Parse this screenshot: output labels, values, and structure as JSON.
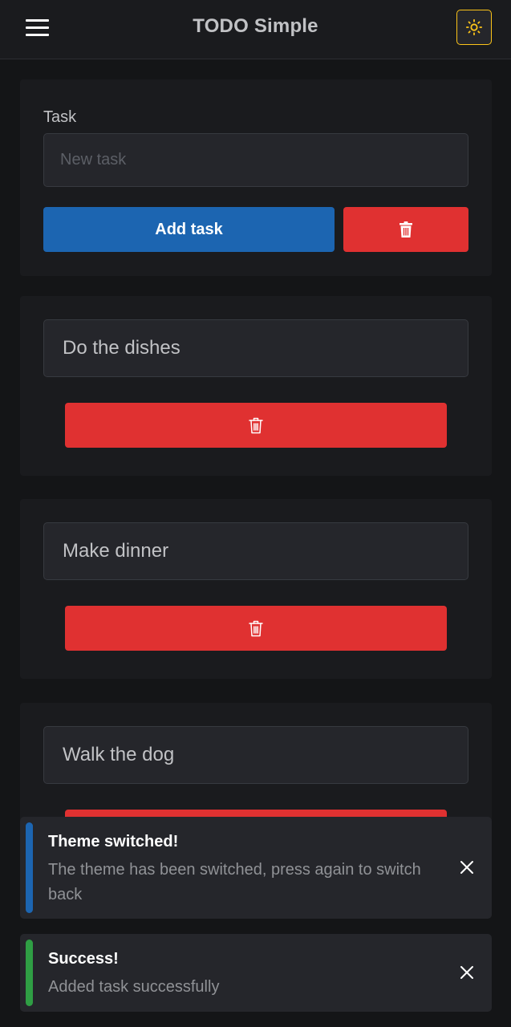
{
  "header": {
    "title": "TODO Simple",
    "menu_icon": "hamburger-menu-icon",
    "theme_icon": "sun-icon",
    "theme_icon_color": "#fcc419"
  },
  "form": {
    "label": "Task",
    "placeholder": "New task",
    "value": "",
    "add_label": "Add task",
    "clear_icon": "trash-icon"
  },
  "tasks": [
    {
      "text": "Do the dishes",
      "delete_icon": "trash-icon"
    },
    {
      "text": "Make dinner",
      "delete_icon": "trash-icon"
    },
    {
      "text": "Walk the dog",
      "delete_icon": "trash-icon"
    }
  ],
  "notifications": [
    {
      "title": "Theme switched!",
      "message": "The theme has been switched, press again to switch back",
      "color": "#1c65b1",
      "close_icon": "close-icon"
    },
    {
      "title": "Success!",
      "message": "Added task successfully",
      "color": "#2f9e44",
      "close_icon": "close-icon"
    }
  ],
  "colors": {
    "primary": "#1c65b1",
    "danger": "#e03131",
    "success": "#2f9e44",
    "accent": "#fcc419"
  }
}
